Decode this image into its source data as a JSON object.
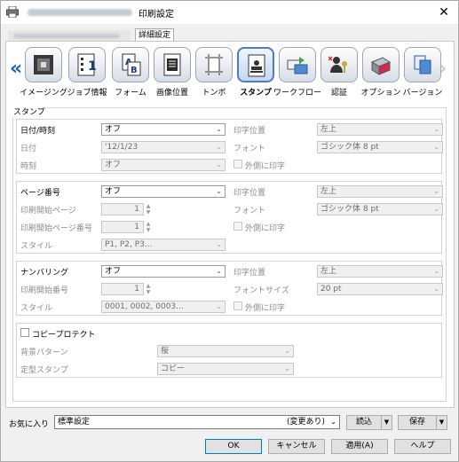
{
  "window": {
    "title": "印刷設定",
    "close_label": "✕",
    "active_tab": "詳細設定"
  },
  "icons": [
    {
      "label": "イメージング",
      "icon": "imaging-icon"
    },
    {
      "label": "ジョブ情報",
      "icon": "job-info-icon"
    },
    {
      "label": "フォーム",
      "icon": "form-icon"
    },
    {
      "label": "画像位置",
      "icon": "image-position-icon"
    },
    {
      "label": "トンボ",
      "icon": "crop-marks-icon"
    },
    {
      "label": "スタンプ",
      "icon": "stamp-icon",
      "selected": true
    },
    {
      "label": "ワークフロー",
      "icon": "workflow-icon"
    },
    {
      "label": "認証",
      "icon": "authentication-icon"
    },
    {
      "label": "オプション",
      "icon": "option-icon"
    },
    {
      "label": "バージョン",
      "icon": "version-icon"
    }
  ],
  "stamp": {
    "group_title": "スタンプ",
    "datetime": {
      "label": "日付/時刻",
      "value": "オフ",
      "date_label": "日付",
      "date_value": "'12/1/23",
      "time_label": "時刻",
      "time_value": "オフ",
      "pos_label": "印字位置",
      "pos_value": "左上",
      "font_label": "フォント",
      "font_value": "ゴシック体 8 pt",
      "outer_label": "外側に印字"
    },
    "page_number": {
      "label": "ページ番号",
      "value": "オフ",
      "start_page_label": "印刷開始ページ",
      "start_page_value": "1",
      "start_num_label": "印刷開始ページ番号",
      "start_num_value": "1",
      "style_label": "スタイル",
      "style_value": "P1, P2, P3...",
      "pos_label": "印字位置",
      "pos_value": "左上",
      "font_label": "フォント",
      "font_value": "ゴシック体 8 pt",
      "outer_label": "外側に印字"
    },
    "numbering": {
      "label": "ナンバリング",
      "value": "オフ",
      "start_label": "印刷開始番号",
      "start_value": "1",
      "style_label": "スタイル",
      "style_value": "0001, 0002, 0003...",
      "pos_label": "印字位置",
      "pos_value": "左上",
      "size_label": "フォントサイズ",
      "size_value": "20 pt",
      "outer_label": "外側に印字"
    },
    "copy_protect": {
      "label": "コピープロテクト",
      "bg_label": "背景パターン",
      "bg_value": "桜",
      "stamp_label": "定型スタンプ",
      "stamp_value": "コピー"
    }
  },
  "favorites": {
    "label": "お気に入り",
    "value": "標準設定",
    "changed": "(変更あり)",
    "load_label": "読込",
    "save_label": "保存"
  },
  "buttons": {
    "ok": "OK",
    "cancel": "キャンセル",
    "apply": "適用(A)",
    "help": "ヘルプ"
  }
}
